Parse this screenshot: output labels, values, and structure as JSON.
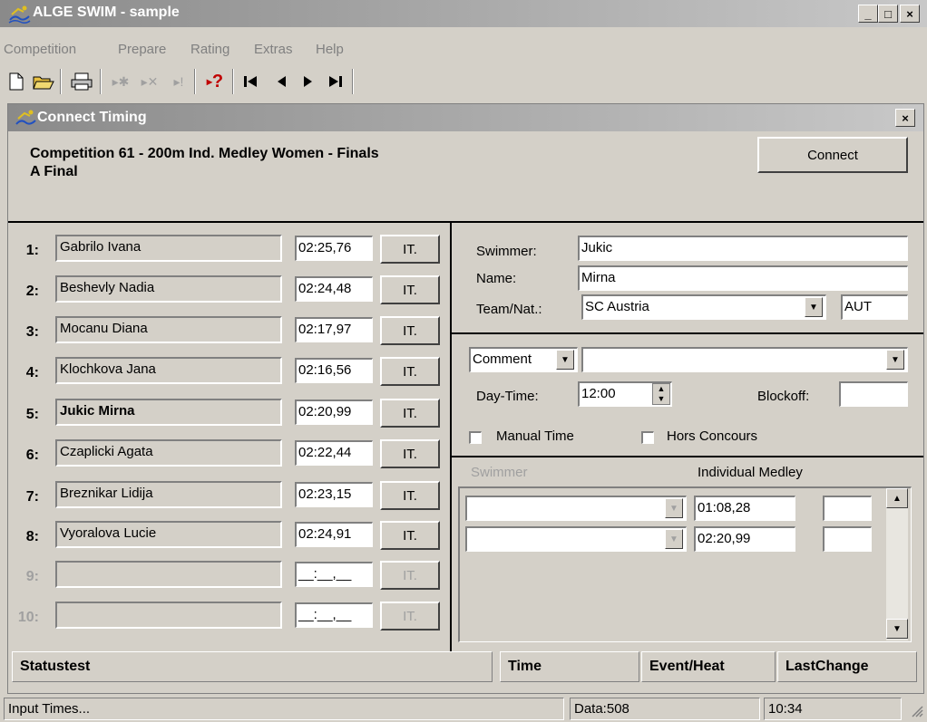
{
  "app": {
    "title": "ALGE SWIM - sample"
  },
  "window_buttons": {
    "minimize": "_",
    "maximize": "□",
    "close": "×"
  },
  "menu": [
    "Competition",
    "Prepare",
    "Rating",
    "Extras",
    "Help"
  ],
  "toolbar": {
    "new_icon": "document-icon",
    "open_icon": "folder-open-icon",
    "print_icon": "printer-icon",
    "help_glyph": "?",
    "first_glyph": "|◀",
    "prev_glyph": "◀",
    "next_glyph": "▶",
    "last_glyph": "▶|"
  },
  "dialog": {
    "title": "Connect Timing",
    "heading_line1": "Competition 61 - 200m Ind. Medley Women  - Finals",
    "heading_line2": "A Final",
    "connect_label": "Connect"
  },
  "lanes": [
    {
      "num": "1:",
      "name": "Gabrilo Ivana",
      "time": "02:25,76",
      "btn": "IT."
    },
    {
      "num": "2:",
      "name": "Beshevly Nadia",
      "time": "02:24,48",
      "btn": "IT."
    },
    {
      "num": "3:",
      "name": "Mocanu Diana",
      "time": "02:17,97",
      "btn": "IT."
    },
    {
      "num": "4:",
      "name": "Klochkova Jana",
      "time": "02:16,56",
      "btn": "IT."
    },
    {
      "num": "5:",
      "name": "Jukic Mirna",
      "time": "02:20,99",
      "btn": "IT."
    },
    {
      "num": "6:",
      "name": "Czaplicki Agata",
      "time": "02:22,44",
      "btn": "IT."
    },
    {
      "num": "7:",
      "name": "Breznikar Lidija",
      "time": "02:23,15",
      "btn": "IT."
    },
    {
      "num": "8:",
      "name": "Vyoralova Lucie",
      "time": "02:24,91",
      "btn": "IT."
    },
    {
      "num": "9:",
      "name": "",
      "time": "__:__,__",
      "btn": "IT."
    },
    {
      "num": "10:",
      "name": "",
      "time": "__:__,__",
      "btn": "IT."
    }
  ],
  "swimmer_panel": {
    "swimmer_label": "Swimmer:",
    "swimmer_value": "Jukic",
    "name_label": "Name:",
    "name_value": "Mirna",
    "team_label": "Team/Nat.:",
    "team_value": "SC Austria",
    "nat_value": "AUT"
  },
  "options_panel": {
    "comment_select": "Comment",
    "comment_value": "",
    "daytime_label": "Day-Time:",
    "daytime_value": "12:00",
    "blockoff_label": "Blockoff:",
    "blockoff_value": "",
    "manual_time_label": "Manual Time",
    "hors_concours_label": "Hors Concours"
  },
  "splits_panel": {
    "swimmer_header": "Swimmer",
    "style_header": "Individual Medley",
    "rows": [
      {
        "swimmer": "",
        "time": "01:08,28",
        "extra": ""
      },
      {
        "swimmer": "",
        "time": "02:20,99",
        "extra": ""
      }
    ]
  },
  "status_header": {
    "status": "Statustest",
    "time": "Time",
    "event": "Event/Heat",
    "lastchange": "LastChange"
  },
  "bottom_status": {
    "message": "Input Times...",
    "data": "Data:508",
    "clock": "10:34"
  }
}
